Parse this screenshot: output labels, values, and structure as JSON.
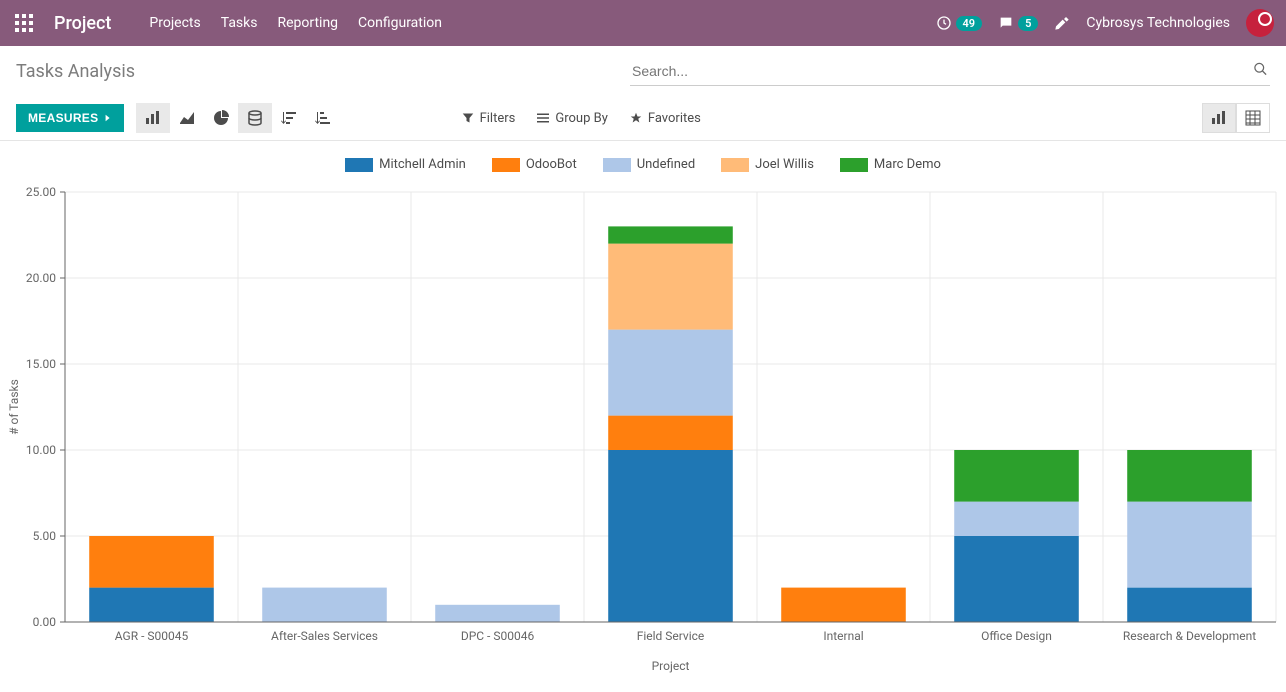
{
  "nav": {
    "brand": "Project",
    "links": [
      "Projects",
      "Tasks",
      "Reporting",
      "Configuration"
    ],
    "activity_count": "49",
    "msg_count": "5",
    "company": "Cybrosys Technologies"
  },
  "breadcrumb": "Tasks Analysis",
  "search": {
    "placeholder": "Search..."
  },
  "measures_label": "MEASURES",
  "filters": {
    "filters": "Filters",
    "group_by": "Group By",
    "favorites": "Favorites"
  },
  "legend_labels": [
    "Mitchell Admin",
    "OdooBot",
    "Undefined",
    "Joel Willis",
    "Marc Demo"
  ],
  "chart_data": {
    "type": "bar",
    "stacked": true,
    "xlabel": "Project",
    "ylabel": "# of Tasks",
    "ylim": [
      0,
      25
    ],
    "yticks": [
      0,
      5,
      10,
      15,
      20,
      25
    ],
    "categories": [
      "AGR - S00045",
      "After-Sales Services",
      "DPC - S00046",
      "Field Service",
      "Internal",
      "Office Design",
      "Research & Development"
    ],
    "colors": {
      "Mitchell Admin": "#1f77b4",
      "OdooBot": "#ff7f0e",
      "Undefined": "#aec7e8",
      "Joel Willis": "#ffbb78",
      "Marc Demo": "#2ca02c"
    },
    "series": [
      {
        "name": "Mitchell Admin",
        "values": [
          2,
          0,
          0,
          10,
          0,
          5,
          2
        ]
      },
      {
        "name": "OdooBot",
        "values": [
          3,
          0,
          0,
          2,
          2,
          0,
          0
        ]
      },
      {
        "name": "Undefined",
        "values": [
          0,
          2,
          1,
          5,
          0,
          2,
          5
        ]
      },
      {
        "name": "Joel Willis",
        "values": [
          0,
          0,
          0,
          5,
          0,
          0,
          0
        ]
      },
      {
        "name": "Marc Demo",
        "values": [
          0,
          0,
          0,
          1,
          0,
          3,
          3
        ]
      }
    ]
  }
}
